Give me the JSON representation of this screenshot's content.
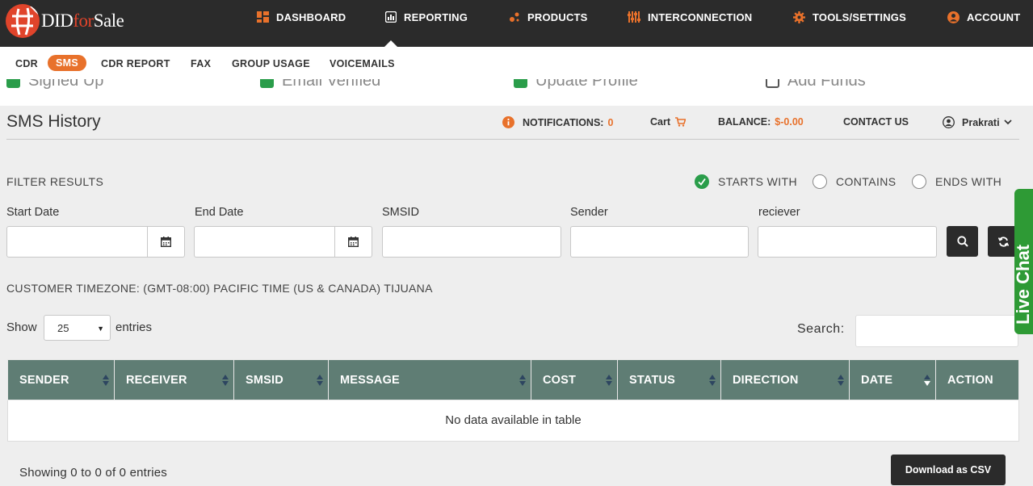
{
  "brand": {
    "name_pre": "DID",
    "name_mid": "for",
    "name_post": "Sale"
  },
  "nav": [
    {
      "id": "dashboard",
      "label": "DASHBOARD",
      "icon": "dashboard-icon"
    },
    {
      "id": "reporting",
      "label": "REPORTING",
      "icon": "bar-chart-icon"
    },
    {
      "id": "products",
      "label": "PRODUCTS",
      "icon": "cubes-icon"
    },
    {
      "id": "interconnection",
      "label": "INTERCONNECTION",
      "icon": "sliders-icon"
    },
    {
      "id": "tools",
      "label": "TOOLS/SETTINGS",
      "icon": "gear-icon"
    },
    {
      "id": "account",
      "label": "ACCOUNT",
      "icon": "user-circle-icon"
    }
  ],
  "subnav": [
    {
      "label": "CDR",
      "active": false
    },
    {
      "label": "SMS",
      "active": true
    },
    {
      "label": "CDR REPORT",
      "active": false
    },
    {
      "label": "FAX",
      "active": false
    },
    {
      "label": "GROUP USAGE",
      "active": false
    },
    {
      "label": "VOICEMAILS",
      "active": false
    }
  ],
  "progress_steps": [
    {
      "label": "Signed Up",
      "done": true
    },
    {
      "label": "Email Verified",
      "done": true
    },
    {
      "label": "Update Profile",
      "done": true
    },
    {
      "label": "Add Funds",
      "done": false
    }
  ],
  "header": {
    "title": "SMS History",
    "notifications_label": "NOTIFICATIONS:",
    "notifications_count": "0",
    "cart_label": "Cart",
    "balance_label": "BALANCE:",
    "balance_value": "$-0.00",
    "contact_label": "CONTACT US",
    "user_name": "Prakrati"
  },
  "filter": {
    "title": "FILTER RESULTS",
    "modes": [
      {
        "label": "STARTS WITH",
        "selected": true
      },
      {
        "label": "CONTAINS",
        "selected": false
      },
      {
        "label": "ENDS WITH",
        "selected": false
      }
    ],
    "fields": {
      "start_date": {
        "label": "Start Date",
        "value": ""
      },
      "end_date": {
        "label": "End Date",
        "value": ""
      },
      "smsid": {
        "label": "SMSID",
        "value": ""
      },
      "sender": {
        "label": "Sender",
        "value": ""
      },
      "receiver": {
        "label": "reciever",
        "value": ""
      }
    }
  },
  "timezone": "CUSTOMER TIMEZONE: (GMT-08:00) PACIFIC TIME (US & CANADA) TIJUANA",
  "table": {
    "show_label": "Show",
    "page_size": "25",
    "entries_label": "entries",
    "search_label": "Search:",
    "search_value": "",
    "columns": [
      "SENDER",
      "RECEIVER",
      "SMSID",
      "MESSAGE",
      "COST",
      "STATUS",
      "DIRECTION",
      "DATE",
      "ACTION"
    ],
    "empty_text": "No data available in table",
    "info": "Showing 0 to 0 of 0 entries"
  },
  "download_label": "Download as CSV",
  "livechat_label": "Live Chat",
  "colors": {
    "accent": "#e8712b",
    "header_bg": "#2b2b2b",
    "table_head": "#5f7d74",
    "check_green": "#2a9d4a"
  }
}
